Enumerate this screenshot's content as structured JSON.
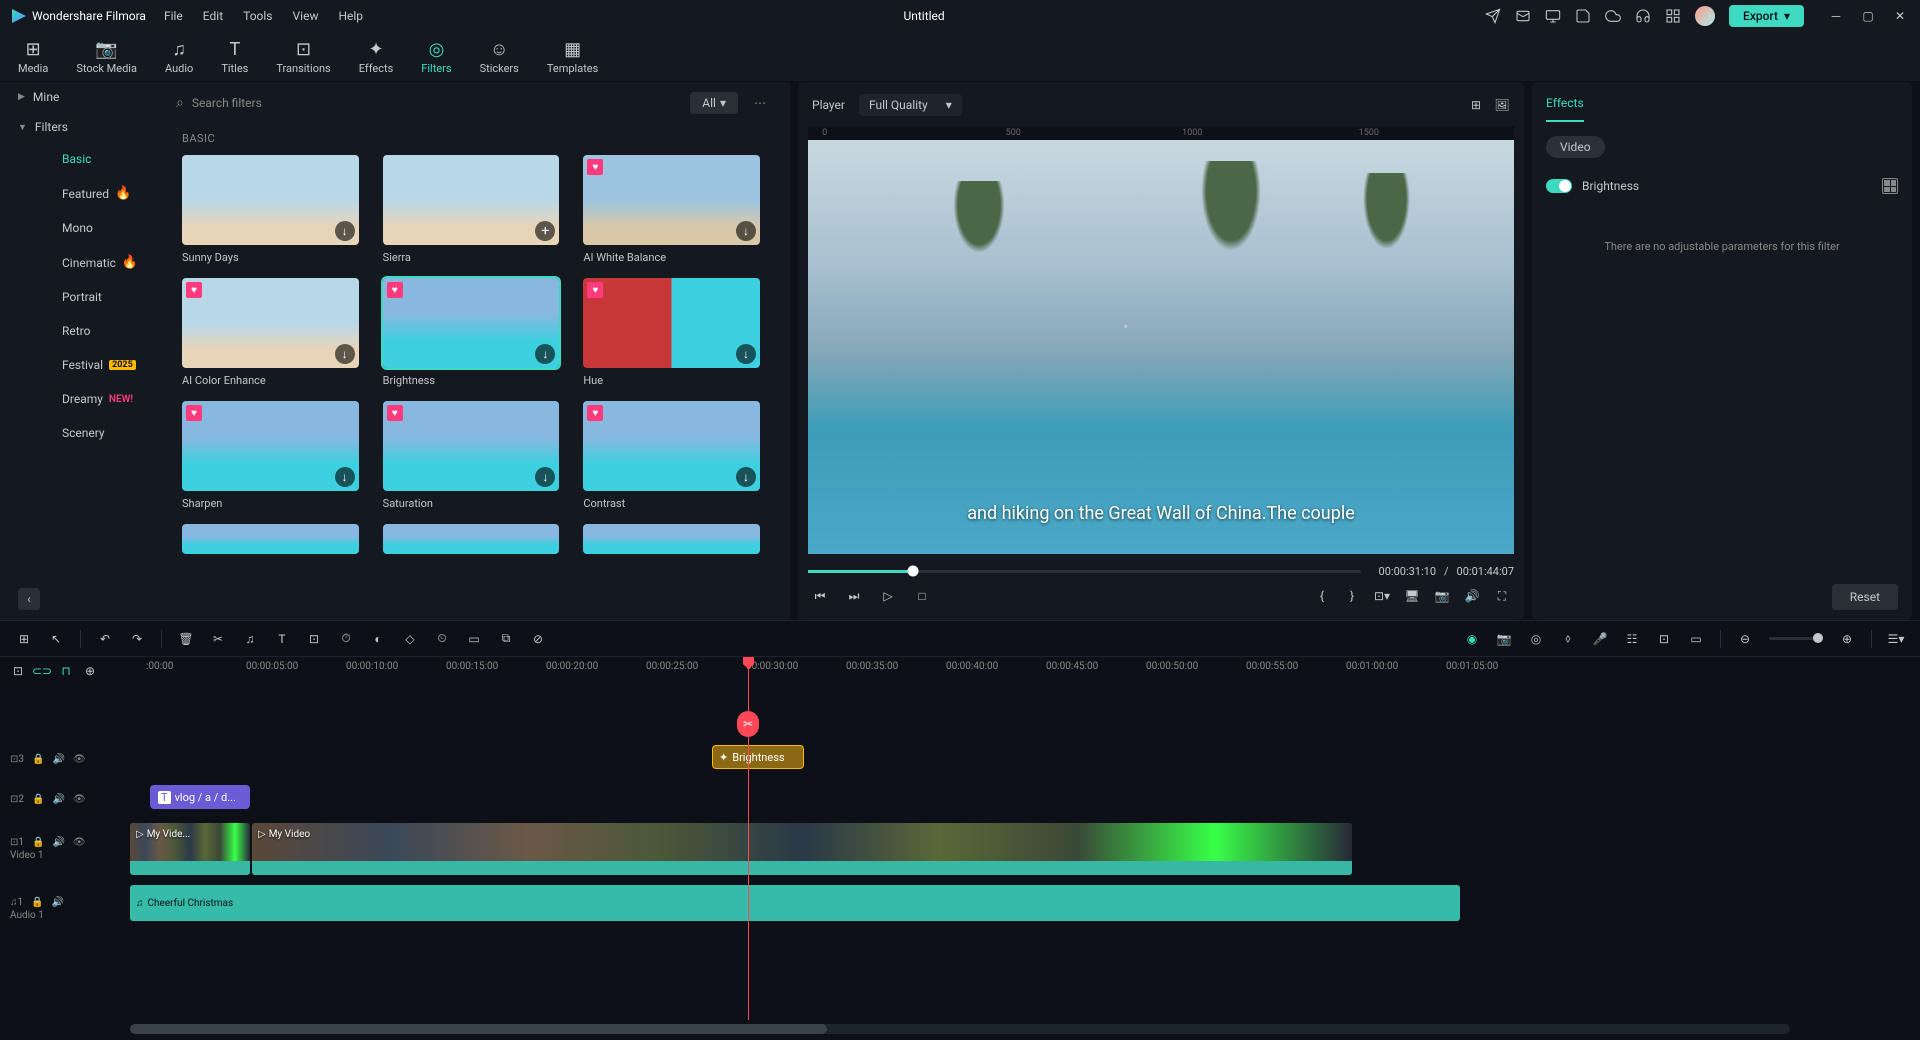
{
  "app": {
    "name": "Wondershare Filmora",
    "document": "Untitled"
  },
  "menu": [
    "File",
    "Edit",
    "Tools",
    "View",
    "Help"
  ],
  "export_label": "Export",
  "tabs": [
    {
      "label": "Media",
      "icon": "⊞"
    },
    {
      "label": "Stock Media",
      "icon": "📷"
    },
    {
      "label": "Audio",
      "icon": "♫"
    },
    {
      "label": "Titles",
      "icon": "T"
    },
    {
      "label": "Transitions",
      "icon": "⊡"
    },
    {
      "label": "Effects",
      "icon": "✦"
    },
    {
      "label": "Filters",
      "icon": "◎",
      "active": true
    },
    {
      "label": "Stickers",
      "icon": "☺"
    },
    {
      "label": "Templates",
      "icon": "▦"
    }
  ],
  "sidebar": {
    "mine": "Mine",
    "filters": "Filters",
    "subs": [
      {
        "label": "Basic",
        "active": true
      },
      {
        "label": "Featured",
        "fire": true
      },
      {
        "label": "Mono"
      },
      {
        "label": "Cinematic",
        "fire": true
      },
      {
        "label": "Portrait"
      },
      {
        "label": "Retro"
      },
      {
        "label": "Festival",
        "year": "2025"
      },
      {
        "label": "Dreamy",
        "new": true
      },
      {
        "label": "Scenery"
      }
    ]
  },
  "search": {
    "placeholder": "Search filters",
    "all": "All"
  },
  "section_label": "BASIC",
  "filters": [
    {
      "name": "Sunny Days",
      "cls": "beach1",
      "dl": true
    },
    {
      "name": "Sierra",
      "cls": "beach1",
      "add": true
    },
    {
      "name": "AI White Balance",
      "cls": "beach2",
      "heart": true,
      "dl": true
    },
    {
      "name": "AI Color Enhance",
      "cls": "beach1",
      "heart": true,
      "dl": true
    },
    {
      "name": "Brightness",
      "cls": "sail1",
      "heart": true,
      "dl": true,
      "selected": true
    },
    {
      "name": "Hue",
      "cls": "sail3",
      "heart": true,
      "dl": true
    },
    {
      "name": "Sharpen",
      "cls": "sail1",
      "heart": true,
      "dl": true
    },
    {
      "name": "Saturation",
      "cls": "sail1",
      "heart": true,
      "dl": true
    },
    {
      "name": "Contrast",
      "cls": "sail1",
      "heart": true,
      "dl": true
    }
  ],
  "player": {
    "label": "Player",
    "quality": "Full Quality",
    "ruler": [
      "0",
      "500",
      "1000",
      "1500"
    ]
  },
  "subtitle": "and hiking on the Great Wall of China.The couple",
  "time": {
    "current": "00:00:31:10",
    "sep": "/",
    "total": "00:01:44:07"
  },
  "effects_panel": {
    "tab": "Effects",
    "video": "Video",
    "brightness": "Brightness",
    "message": "There are no adjustable parameters for this filter",
    "reset": "Reset"
  },
  "ruler_ticks": [
    ":00:00",
    "00:00:05:00",
    "00:00:10:00",
    "00:00:15:00",
    "00:00:20:00",
    "00:00:25:00",
    "00:00:30:00",
    "00:00:35:00",
    "00:00:40:00",
    "00:00:45:00",
    "00:00:50:00",
    "00:00:55:00",
    "00:01:00:00",
    "00:01:05:00"
  ],
  "tracks": {
    "effect_clip": "Brightness",
    "text_clip": "vlog / a / d...",
    "video_clip1": "My Vide...",
    "video_clip2": "My Video",
    "video_track": "Video 1",
    "audio_track": "Audio 1",
    "audio_clip": "Cheerful Christmas"
  }
}
